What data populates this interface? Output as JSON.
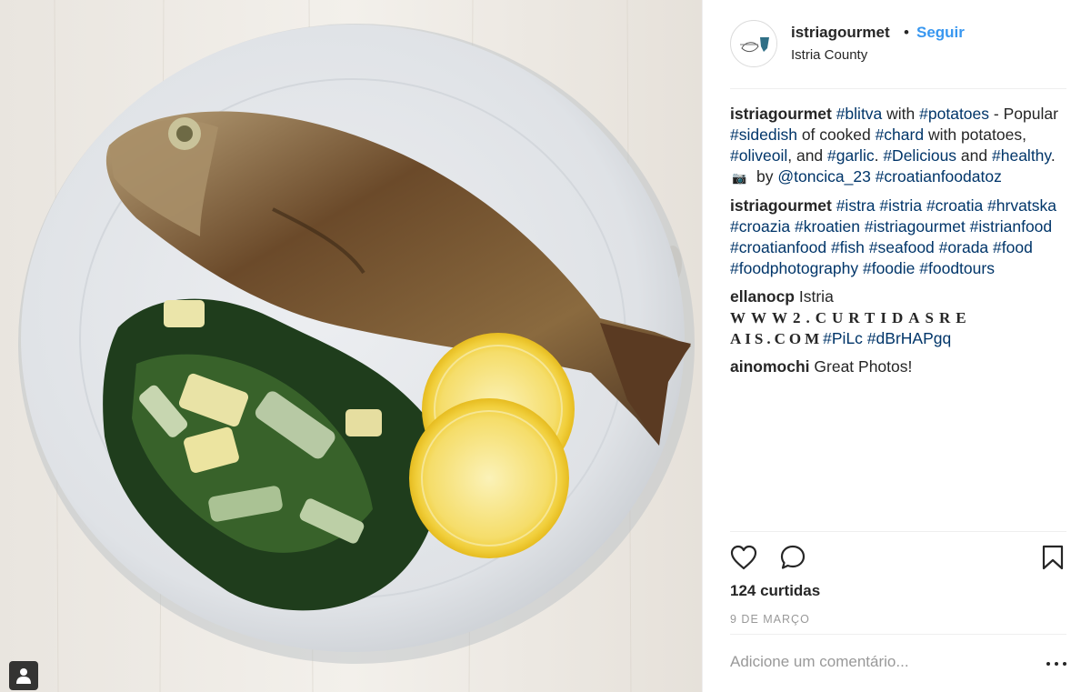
{
  "post": {
    "username": "istriagourmet",
    "dot": "•",
    "follow_label": "Seguir",
    "location": "Istria County",
    "likes_text": "124 curtidas",
    "date_text": "9 DE MARÇO",
    "comment_placeholder": "Adicione um comentário..."
  },
  "icons": {
    "tag_people": "person-tag-icon",
    "like": "heart-icon",
    "comment": "comment-bubble-icon",
    "save": "bookmark-icon",
    "more": "more-options-icon",
    "camera_emoji": "📷"
  },
  "colors": {
    "link_blue": "#3897f0",
    "hashtag": "#003569",
    "meta_gray": "#999999"
  },
  "comments": [
    {
      "user": "istriagourmet",
      "parts": [
        {
          "t": "tag",
          "v": "#blitva"
        },
        {
          "t": "text",
          "v": " with "
        },
        {
          "t": "tag",
          "v": "#potatoes"
        },
        {
          "t": "text",
          "v": " - Popular "
        },
        {
          "t": "tag",
          "v": "#sidedish"
        },
        {
          "t": "text",
          "v": " of cooked "
        },
        {
          "t": "tag",
          "v": "#chard"
        },
        {
          "t": "text",
          "v": " with potatoes, "
        },
        {
          "t": "tag",
          "v": "#oliveoil"
        },
        {
          "t": "text",
          "v": ", and "
        },
        {
          "t": "tag",
          "v": "#garlic"
        },
        {
          "t": "text",
          "v": ". "
        },
        {
          "t": "tag",
          "v": "#Delicious"
        },
        {
          "t": "text",
          "v": " and "
        },
        {
          "t": "tag",
          "v": "#healthy"
        },
        {
          "t": "text",
          "v": ". "
        },
        {
          "t": "cam",
          "v": "📷"
        },
        {
          "t": "text",
          "v": " by "
        },
        {
          "t": "tag",
          "v": "@toncica_23"
        },
        {
          "t": "text",
          "v": " "
        },
        {
          "t": "tag",
          "v": "#croatianfoodatoz"
        }
      ]
    },
    {
      "user": "istriagourmet",
      "parts": [
        {
          "t": "tag",
          "v": "#istra"
        },
        {
          "t": "text",
          "v": " "
        },
        {
          "t": "tag",
          "v": "#istria"
        },
        {
          "t": "text",
          "v": " "
        },
        {
          "t": "tag",
          "v": "#croatia"
        },
        {
          "t": "text",
          "v": " "
        },
        {
          "t": "tag",
          "v": "#hrvatska"
        },
        {
          "t": "text",
          "v": " "
        },
        {
          "t": "tag",
          "v": "#croazia"
        },
        {
          "t": "text",
          "v": " "
        },
        {
          "t": "tag",
          "v": "#kroatien"
        },
        {
          "t": "text",
          "v": " "
        },
        {
          "t": "tag",
          "v": "#istriagourmet"
        },
        {
          "t": "text",
          "v": " "
        },
        {
          "t": "tag",
          "v": "#istrianfood"
        },
        {
          "t": "text",
          "v": " "
        },
        {
          "t": "tag",
          "v": "#croatianfood"
        },
        {
          "t": "text",
          "v": " "
        },
        {
          "t": "tag",
          "v": "#fish"
        },
        {
          "t": "text",
          "v": " "
        },
        {
          "t": "tag",
          "v": "#seafood"
        },
        {
          "t": "text",
          "v": " "
        },
        {
          "t": "tag",
          "v": "#orada"
        },
        {
          "t": "text",
          "v": " "
        },
        {
          "t": "tag",
          "v": "#food"
        },
        {
          "t": "text",
          "v": " "
        },
        {
          "t": "tag",
          "v": "#foodphotography"
        },
        {
          "t": "text",
          "v": " "
        },
        {
          "t": "tag",
          "v": "#foodie"
        },
        {
          "t": "text",
          "v": " "
        },
        {
          "t": "tag",
          "v": "#foodtours"
        }
      ]
    },
    {
      "user": "ellanocp",
      "parts": [
        {
          "t": "text",
          "v": " Istria "
        },
        {
          "t": "serif",
          "v": "WWW2.CURTIDASRE"
        },
        {
          "t": "serif2",
          "v": " AIS.COM"
        },
        {
          "t": "tag",
          "v": "#PiLc"
        },
        {
          "t": "text",
          "v": " "
        },
        {
          "t": "tag",
          "v": "#dBrHAPgq"
        }
      ]
    },
    {
      "user": "ainomochi",
      "parts": [
        {
          "t": "text",
          "v": " Great Photos!"
        }
      ]
    }
  ]
}
